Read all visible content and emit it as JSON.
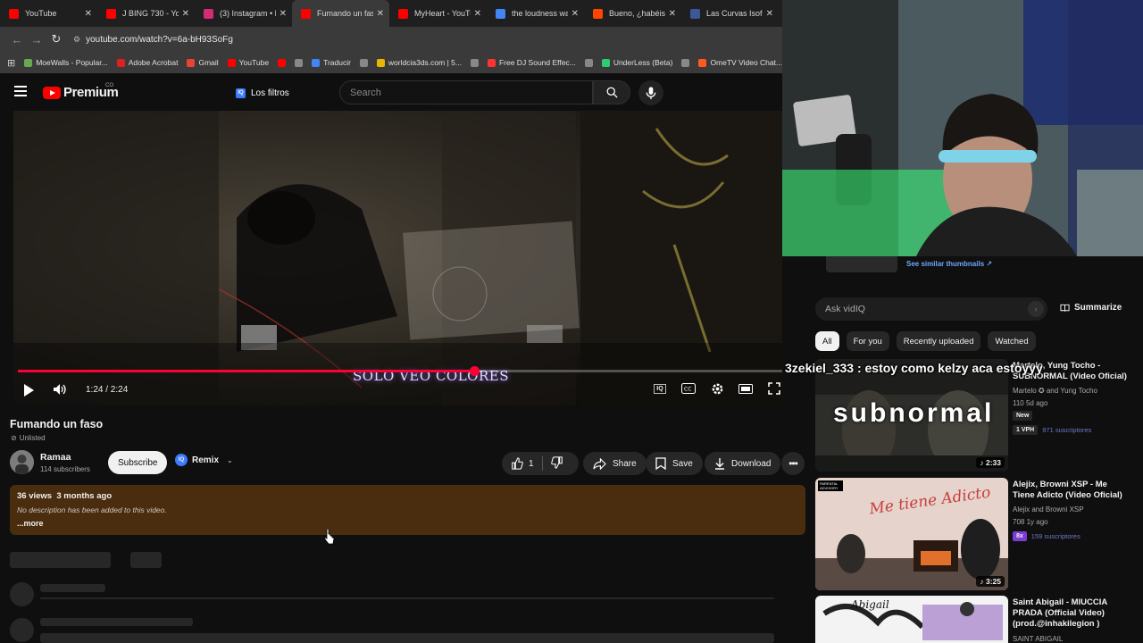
{
  "browser": {
    "tabs": [
      {
        "title": "YouTube",
        "color": "#ff0000"
      },
      {
        "title": "J BING 730 - You",
        "color": "#ff0000"
      },
      {
        "title": "(3) Instagram • M",
        "color": "#d62976"
      },
      {
        "title": "Fumando un faso",
        "color": "#ff0000",
        "active": true
      },
      {
        "title": "MyHeart - YouTu",
        "color": "#ff0000"
      },
      {
        "title": "the loudness war",
        "color": "#4285f4"
      },
      {
        "title": "Bueno, ¿habéis o",
        "color": "#ff4500"
      },
      {
        "title": "Las Curvas Isofó",
        "color": "#3b5998"
      }
    ],
    "url": "youtube.com/watch?v=6a-bH93SoFg",
    "bookmarks": [
      {
        "label": "MoeWalls - Popular...",
        "color": "#6aa84f"
      },
      {
        "label": "Adobe Acrobat",
        "color": "#e02020"
      },
      {
        "label": "Gmail",
        "color": "#ea4335"
      },
      {
        "label": "YouTube",
        "color": "#ff0000"
      },
      {
        "label": "",
        "color": "#ff0000"
      },
      {
        "label": "",
        "color": "#888888"
      },
      {
        "label": "Traducir",
        "color": "#4285f4"
      },
      {
        "label": "",
        "color": "#888888"
      },
      {
        "label": "worldcia3ds.com | 5...",
        "color": "#e6b800"
      },
      {
        "label": "",
        "color": "#888888"
      },
      {
        "label": "Free DJ Sound Effec...",
        "color": "#ff3333"
      },
      {
        "label": "",
        "color": "#888888"
      },
      {
        "label": "UnderLess (Beta)",
        "color": "#2ecc71"
      },
      {
        "label": "",
        "color": "#888888"
      },
      {
        "label": "OmeTV Video Chat...",
        "color": "#ff5a1f"
      }
    ]
  },
  "header": {
    "logo_word": "Premium",
    "country": "CO",
    "filters_label": "Los filtros",
    "filters_badge": "IQ",
    "search_placeholder": "Search"
  },
  "player": {
    "time": "1:24 / 2:24",
    "progress": 0.597,
    "subtitle": "SOLO VEO COLORES",
    "iq_badge": "IQ"
  },
  "video": {
    "title": "Fumando un faso",
    "visibility": "Unlisted",
    "channel": "Ramaa",
    "subscribers": "114 subscribers",
    "subscribe_label": "Subscribe",
    "remix_label": "Remix",
    "remix_badge": "IQ",
    "likes": "1",
    "share_label": "Share",
    "save_label": "Save",
    "download_label": "Download",
    "description_meta": "36 views  3 months ago",
    "description_body": "No description has been added to this video.",
    "more_label": "...more"
  },
  "sidebar": {
    "similar_link": "See similar thumbnails ↗",
    "ask_placeholder": "Ask vidIQ",
    "summarize_label": "Summarize",
    "chips": [
      "All",
      "For you",
      "Recently uploaded",
      "Watched"
    ],
    "recs": [
      {
        "title": "Martelo, Yung Tocho - SUBNORMAL (Video Oficial)",
        "author": "Martelo ✪ and Yung Tocho",
        "stats": "110  5d ago",
        "badge": "New",
        "vph": "1 VPH",
        "subs": "971 suscriptores",
        "duration": "2:33",
        "thumb_text": "subnormal"
      },
      {
        "title": "Alejix, Browni XSP - Me Tiene Adicto (Video Oficial)",
        "author": "Alejix and Browni XSP",
        "stats": "708  1y ago",
        "vph": "8x",
        "subs": "159 suscriptores",
        "duration": "3:25",
        "thumb_text": "Me tiene Adicto",
        "rating": "PARENTAL ADVISORY"
      },
      {
        "title": "Saint Abigail - MIUCCIA PRADA (Official Video) (prod.@inhakilegion )",
        "author": "SAINT ABIGAIL",
        "thumb_text": "Abigail"
      }
    ]
  },
  "chat_overlay": "3zekiel_333 : estoy como kelzy aca estoyyy"
}
